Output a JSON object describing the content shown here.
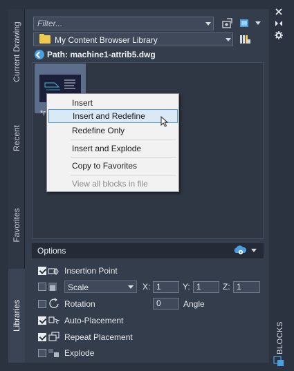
{
  "left_tabs": [
    {
      "label": "Current Drawing",
      "active": false
    },
    {
      "label": "Recent",
      "active": false
    },
    {
      "label": "Favorites",
      "active": false
    },
    {
      "label": "Libraries",
      "active": true
    }
  ],
  "filter": {
    "placeholder": "Filter..."
  },
  "library": {
    "label": "My Content Browser Library"
  },
  "path": {
    "label": "Path: machine1-attrib5.dwg"
  },
  "thumbnail": {
    "caption_prefix": "*r"
  },
  "context_menu": {
    "items": [
      {
        "label": "Insert",
        "highlighted": false,
        "disabled": false
      },
      {
        "label": "Insert and Redefine",
        "highlighted": true,
        "disabled": false
      },
      {
        "label": "Redefine Only",
        "highlighted": false,
        "disabled": false
      },
      {
        "label": "Insert and Explode",
        "highlighted": false,
        "disabled": false
      },
      {
        "label": "Copy to Favorites",
        "highlighted": false,
        "disabled": false
      },
      {
        "label": "View all blocks in file",
        "highlighted": false,
        "disabled": true
      }
    ]
  },
  "options": {
    "title": "Options",
    "insertion_point": {
      "label": "Insertion Point",
      "checked": true
    },
    "scale": {
      "checked": false,
      "selected": "Scale",
      "x_label": "X:",
      "x_value": "1",
      "y_label": "Y:",
      "y_value": "1",
      "z_label": "Z:",
      "z_value": "1"
    },
    "rotation": {
      "label": "Rotation",
      "checked": false,
      "angle_value": "0",
      "angle_label": "Angle"
    },
    "auto_placement": {
      "label": "Auto-Placement",
      "checked": true
    },
    "repeat_placement": {
      "label": "Repeat Placement",
      "checked": true
    },
    "explode": {
      "label": "Explode",
      "checked": false
    }
  },
  "palette": {
    "title": "BLOCKS"
  },
  "colors": {
    "accent": "#4a9fe0",
    "highlight": "#dbe9f7",
    "folder": "#f0c94d"
  }
}
